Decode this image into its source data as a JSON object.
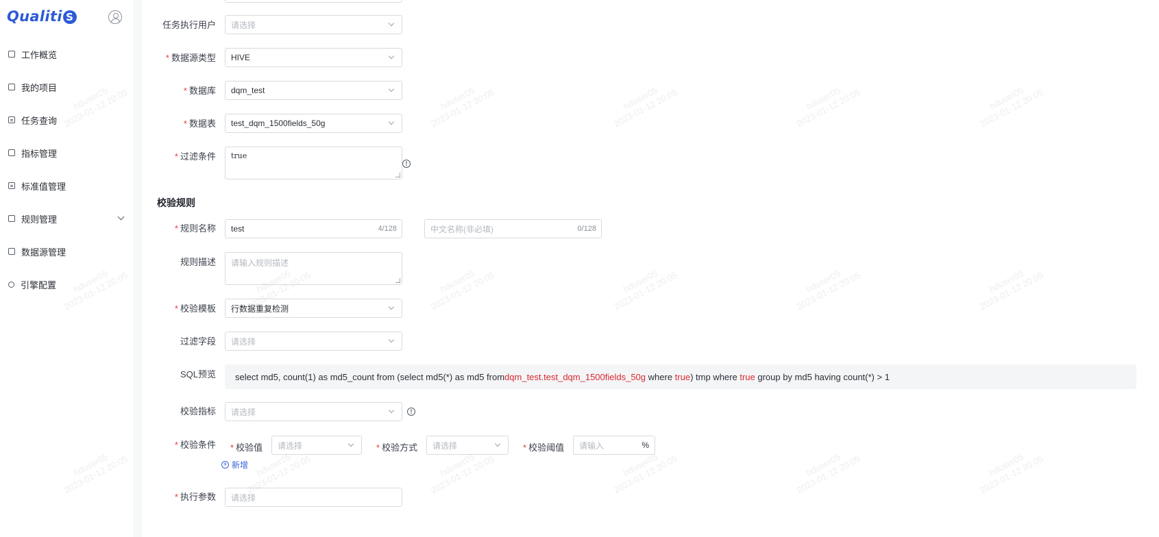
{
  "app": {
    "logo_text": "Qualiti",
    "logo_suffix": "S"
  },
  "sidebar": {
    "items": [
      {
        "label": "工作概览",
        "icon": "dashboard-icon"
      },
      {
        "label": "我的项目",
        "icon": "folder-icon"
      },
      {
        "label": "任务查询",
        "icon": "document-icon"
      },
      {
        "label": "指标管理",
        "icon": "metric-icon"
      },
      {
        "label": "标准值管理",
        "icon": "standard-icon"
      },
      {
        "label": "规则管理",
        "icon": "rule-icon"
      },
      {
        "label": "数据源管理",
        "icon": "datasource-icon"
      },
      {
        "label": "引擎配置",
        "icon": "engine-icon"
      }
    ]
  },
  "form": {
    "exec_user": {
      "label": "任务执行用户",
      "placeholder": "请选择"
    },
    "ds_type": {
      "label": "数据源类型",
      "value": "HIVE"
    },
    "database": {
      "label": "数据库",
      "value": "dqm_test"
    },
    "table": {
      "label": "数据表",
      "value": "test_dqm_1500fields_50g"
    },
    "filter": {
      "label": "过滤条件",
      "value": "true"
    }
  },
  "rules": {
    "section_title": "校验规则",
    "rule_name": {
      "label": "规则名称",
      "value": "test",
      "counter": "4/128"
    },
    "rule_cn_name": {
      "placeholder": "中文名称(非必填)",
      "counter": "0/128"
    },
    "rule_desc": {
      "label": "规则描述",
      "placeholder": "请输入规则描述"
    },
    "template": {
      "label": "校验模板",
      "value": "行数据重复检测"
    },
    "filter_field": {
      "label": "过滤字段",
      "placeholder": "请选择"
    },
    "sql_preview": {
      "label": "SQL预览",
      "part1": "select md5, count(1) as md5_count from (select md5(*) as md5 from ",
      "table_ref": "dqm_test.test_dqm_1500fields_50g",
      "part2": " where ",
      "cond1": "true",
      "part3": ") tmp where ",
      "cond2": "true",
      "part4": " group by md5 having count(*) > 1"
    },
    "metric": {
      "label": "校验指标",
      "placeholder": "请选择"
    },
    "condition": {
      "label": "校验条件",
      "value_label": "校验值",
      "value_placeholder": "请选择",
      "method_label": "校验方式",
      "method_placeholder": "请选择",
      "threshold_label": "校验阈值",
      "threshold_placeholder": "请输入",
      "threshold_unit": "%",
      "add_label": "新增"
    },
    "exec_params": {
      "label": "执行参数",
      "placeholder": "请选择"
    }
  },
  "watermark": {
    "line1": "hduser05",
    "line2": "2023-01-12 20:05"
  },
  "colors": {
    "accent": "#2d5ad6",
    "required": "#f03a3a",
    "sql_highlight": "#d9292f"
  }
}
